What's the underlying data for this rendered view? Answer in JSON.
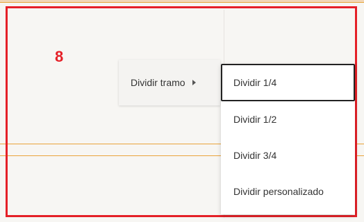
{
  "cell": {
    "number": "8"
  },
  "context_menu": {
    "item_label": "Dividir tramo"
  },
  "submenu": {
    "items": [
      {
        "label": "Dividir 1/4",
        "active": true
      },
      {
        "label": "Dividir 1/2",
        "active": false
      },
      {
        "label": "Dividir 3/4",
        "active": false
      },
      {
        "label": "Dividir personalizado",
        "active": false
      }
    ]
  },
  "colors": {
    "highlight_border": "#e52027",
    "guide_line": "#e9a33a",
    "menu_bg": "#f4f3f1",
    "submenu_bg": "#ffffff"
  }
}
